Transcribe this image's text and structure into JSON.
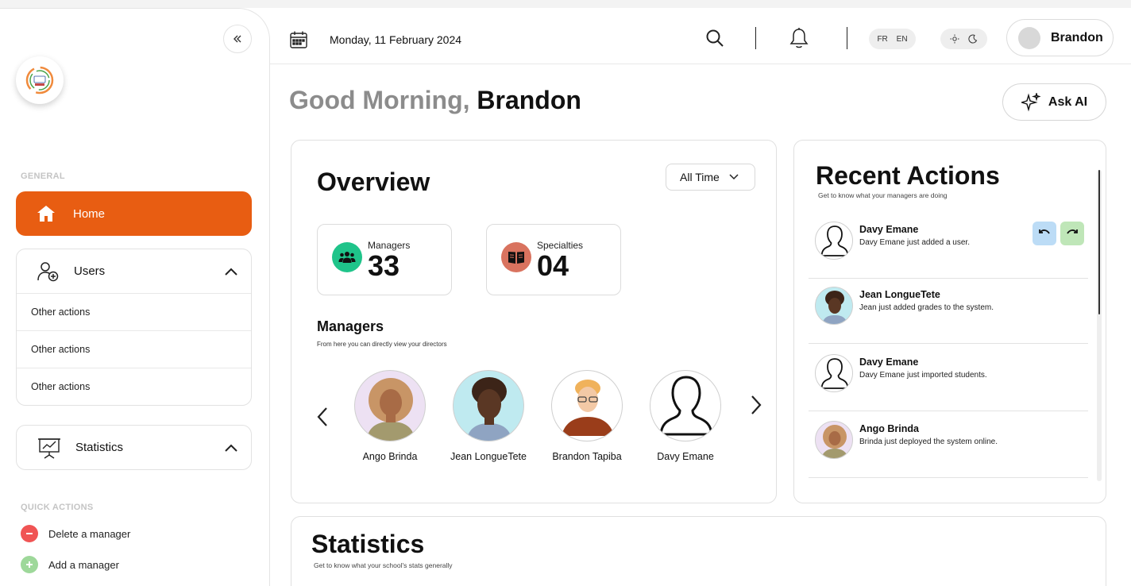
{
  "header": {
    "date": "Monday, 11 February 2024",
    "lang_fr": "FR",
    "lang_en": "EN",
    "user_name": "Brandon"
  },
  "sidebar": {
    "general_label": "GENERAL",
    "home_label": "Home",
    "users": {
      "label": "Users",
      "items": [
        "Other actions",
        "Other actions",
        "Other actions"
      ]
    },
    "statistics_label": "Statistics",
    "quick_actions_label": "QUICK ACTIONS",
    "quick_actions": [
      "Delete a manager",
      "Add a manager"
    ]
  },
  "greeting": {
    "prefix": "Good Morning,",
    "name": "Brandon"
  },
  "ask_ai_label": "Ask AI",
  "overview": {
    "title": "Overview",
    "filter": "All Time",
    "stats": [
      {
        "label": "Managers",
        "value": "33"
      },
      {
        "label": "Specialties",
        "value": "04"
      }
    ],
    "managers_title": "Managers",
    "managers_subtitle": "From here you can directly view your directors",
    "managers": [
      "Ango Brinda",
      "Jean LongueTete",
      "Brandon Tapiba",
      "Davy Emane"
    ]
  },
  "recent_actions": {
    "title": "Recent Actions",
    "subtitle": "Get to know what your managers are doing",
    "items": [
      {
        "name": "Davy Emane",
        "desc": "Davy Emane just added a user."
      },
      {
        "name": "Jean LongueTete",
        "desc": "Jean just added grades to the system."
      },
      {
        "name": "Davy Emane",
        "desc": "Davy Emane just imported students."
      },
      {
        "name": "Ango Brinda",
        "desc": "Brinda just deployed the system online."
      }
    ]
  },
  "statistics": {
    "title": "Statistics",
    "subtitle": "Get to know what your school's stats generally"
  },
  "colors": {
    "accent": "#e85d12",
    "managers_icon": "#1fc48a",
    "specialties_icon": "#d9735f",
    "delete": "#f05454",
    "add": "#9ed89a"
  }
}
